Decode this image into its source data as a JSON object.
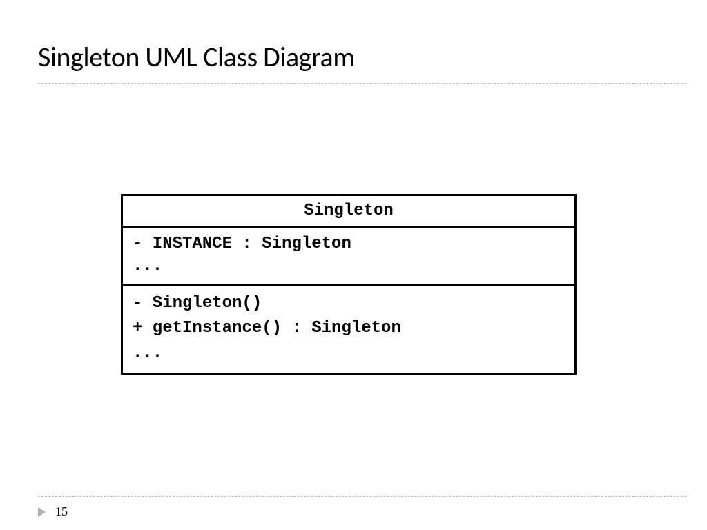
{
  "slide": {
    "title": "Singleton UML Class Diagram",
    "page_number": "15"
  },
  "uml": {
    "class_name": "Singleton",
    "attributes": "- INSTANCE : Singleton\n...",
    "methods": "- Singleton()\n+ getInstance() : Singleton\n..."
  }
}
